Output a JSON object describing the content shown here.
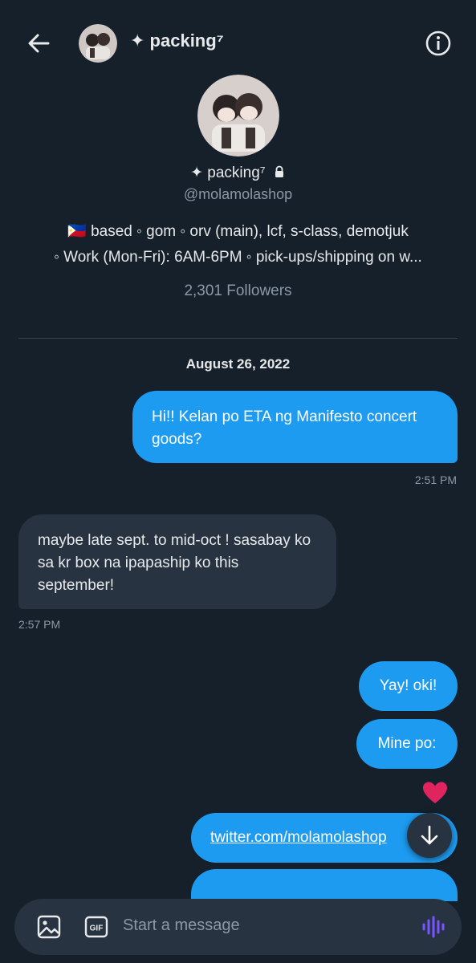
{
  "header": {
    "name": "✦ packing⁷",
    "avatar_icon": "profile-avatar",
    "back_icon": "arrow-left-icon",
    "info_icon": "info-circle-icon"
  },
  "profile": {
    "name": "✦ packing⁷",
    "handle": "@molamolashop",
    "bio_line1": "🇵🇭 based ◦ gom ◦ orv (main), lcf, s-class, demotjuk",
    "bio_line2": "◦ Work (Mon-Fri): 6AM-6PM ◦ pick-ups/shipping on w...",
    "followers": "2,301 Followers"
  },
  "conversation": {
    "date": "August 26, 2022",
    "messages": [
      {
        "direction": "sent",
        "text": "Hi!! Kelan po ETA ng Manifesto concert goods?",
        "time": "2:51 PM"
      },
      {
        "direction": "received",
        "text": "maybe late sept. to mid-oct ! sasabay ko sa kr box na ipapaship ko this september!",
        "time": "2:57 PM"
      },
      {
        "direction": "sent",
        "text": "Yay! oki!"
      },
      {
        "direction": "sent",
        "text": "Mine po:",
        "reaction": "heart"
      },
      {
        "direction": "sent",
        "text": "twitter.com/molamolashop",
        "is_link": true
      }
    ]
  },
  "composer": {
    "placeholder": "Start a message",
    "image_icon": "image-icon",
    "gif_label": "GIF",
    "voice_icon": "voice-waveform-icon"
  },
  "colors": {
    "background": "#15202b",
    "sent_bubble": "#1d9bf0",
    "received_bubble": "#273340",
    "voice_accent": "#7856ff"
  }
}
